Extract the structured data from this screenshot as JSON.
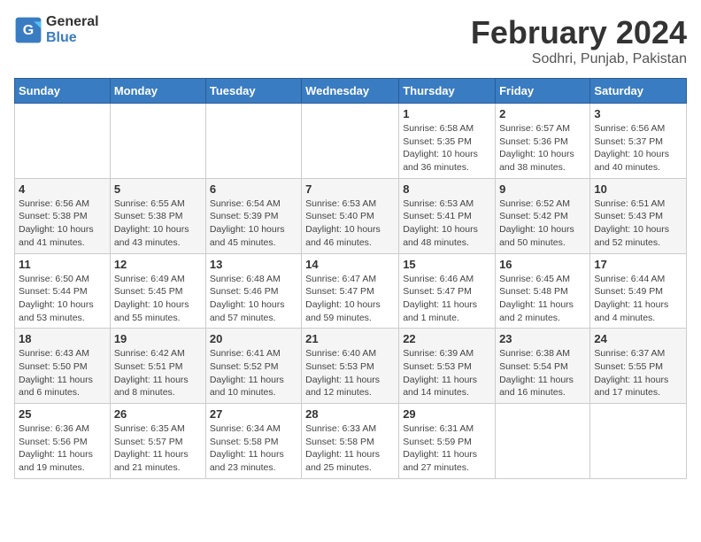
{
  "logo": {
    "line1": "General",
    "line2": "Blue"
  },
  "title": "February 2024",
  "subtitle": "Sodhri, Punjab, Pakistan",
  "days_of_week": [
    "Sunday",
    "Monday",
    "Tuesday",
    "Wednesday",
    "Thursday",
    "Friday",
    "Saturday"
  ],
  "weeks": [
    [
      {
        "day": "",
        "info": ""
      },
      {
        "day": "",
        "info": ""
      },
      {
        "day": "",
        "info": ""
      },
      {
        "day": "",
        "info": ""
      },
      {
        "day": "1",
        "info": "Sunrise: 6:58 AM\nSunset: 5:35 PM\nDaylight: 10 hours\nand 36 minutes."
      },
      {
        "day": "2",
        "info": "Sunrise: 6:57 AM\nSunset: 5:36 PM\nDaylight: 10 hours\nand 38 minutes."
      },
      {
        "day": "3",
        "info": "Sunrise: 6:56 AM\nSunset: 5:37 PM\nDaylight: 10 hours\nand 40 minutes."
      }
    ],
    [
      {
        "day": "4",
        "info": "Sunrise: 6:56 AM\nSunset: 5:38 PM\nDaylight: 10 hours\nand 41 minutes."
      },
      {
        "day": "5",
        "info": "Sunrise: 6:55 AM\nSunset: 5:38 PM\nDaylight: 10 hours\nand 43 minutes."
      },
      {
        "day": "6",
        "info": "Sunrise: 6:54 AM\nSunset: 5:39 PM\nDaylight: 10 hours\nand 45 minutes."
      },
      {
        "day": "7",
        "info": "Sunrise: 6:53 AM\nSunset: 5:40 PM\nDaylight: 10 hours\nand 46 minutes."
      },
      {
        "day": "8",
        "info": "Sunrise: 6:53 AM\nSunset: 5:41 PM\nDaylight: 10 hours\nand 48 minutes."
      },
      {
        "day": "9",
        "info": "Sunrise: 6:52 AM\nSunset: 5:42 PM\nDaylight: 10 hours\nand 50 minutes."
      },
      {
        "day": "10",
        "info": "Sunrise: 6:51 AM\nSunset: 5:43 PM\nDaylight: 10 hours\nand 52 minutes."
      }
    ],
    [
      {
        "day": "11",
        "info": "Sunrise: 6:50 AM\nSunset: 5:44 PM\nDaylight: 10 hours\nand 53 minutes."
      },
      {
        "day": "12",
        "info": "Sunrise: 6:49 AM\nSunset: 5:45 PM\nDaylight: 10 hours\nand 55 minutes."
      },
      {
        "day": "13",
        "info": "Sunrise: 6:48 AM\nSunset: 5:46 PM\nDaylight: 10 hours\nand 57 minutes."
      },
      {
        "day": "14",
        "info": "Sunrise: 6:47 AM\nSunset: 5:47 PM\nDaylight: 10 hours\nand 59 minutes."
      },
      {
        "day": "15",
        "info": "Sunrise: 6:46 AM\nSunset: 5:47 PM\nDaylight: 11 hours\nand 1 minute."
      },
      {
        "day": "16",
        "info": "Sunrise: 6:45 AM\nSunset: 5:48 PM\nDaylight: 11 hours\nand 2 minutes."
      },
      {
        "day": "17",
        "info": "Sunrise: 6:44 AM\nSunset: 5:49 PM\nDaylight: 11 hours\nand 4 minutes."
      }
    ],
    [
      {
        "day": "18",
        "info": "Sunrise: 6:43 AM\nSunset: 5:50 PM\nDaylight: 11 hours\nand 6 minutes."
      },
      {
        "day": "19",
        "info": "Sunrise: 6:42 AM\nSunset: 5:51 PM\nDaylight: 11 hours\nand 8 minutes."
      },
      {
        "day": "20",
        "info": "Sunrise: 6:41 AM\nSunset: 5:52 PM\nDaylight: 11 hours\nand 10 minutes."
      },
      {
        "day": "21",
        "info": "Sunrise: 6:40 AM\nSunset: 5:53 PM\nDaylight: 11 hours\nand 12 minutes."
      },
      {
        "day": "22",
        "info": "Sunrise: 6:39 AM\nSunset: 5:53 PM\nDaylight: 11 hours\nand 14 minutes."
      },
      {
        "day": "23",
        "info": "Sunrise: 6:38 AM\nSunset: 5:54 PM\nDaylight: 11 hours\nand 16 minutes."
      },
      {
        "day": "24",
        "info": "Sunrise: 6:37 AM\nSunset: 5:55 PM\nDaylight: 11 hours\nand 17 minutes."
      }
    ],
    [
      {
        "day": "25",
        "info": "Sunrise: 6:36 AM\nSunset: 5:56 PM\nDaylight: 11 hours\nand 19 minutes."
      },
      {
        "day": "26",
        "info": "Sunrise: 6:35 AM\nSunset: 5:57 PM\nDaylight: 11 hours\nand 21 minutes."
      },
      {
        "day": "27",
        "info": "Sunrise: 6:34 AM\nSunset: 5:58 PM\nDaylight: 11 hours\nand 23 minutes."
      },
      {
        "day": "28",
        "info": "Sunrise: 6:33 AM\nSunset: 5:58 PM\nDaylight: 11 hours\nand 25 minutes."
      },
      {
        "day": "29",
        "info": "Sunrise: 6:31 AM\nSunset: 5:59 PM\nDaylight: 11 hours\nand 27 minutes."
      },
      {
        "day": "",
        "info": ""
      },
      {
        "day": "",
        "info": ""
      }
    ]
  ]
}
